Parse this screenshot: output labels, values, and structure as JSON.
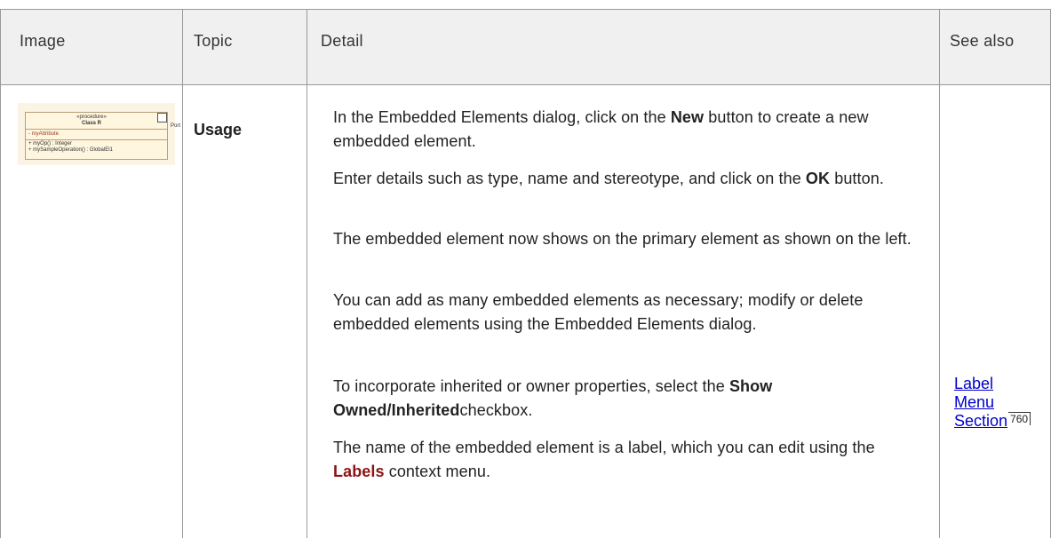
{
  "headers": {
    "image": "Image",
    "topic": "Topic",
    "detail": "Detail",
    "see_also": "See also"
  },
  "row": {
    "topic": "Usage",
    "thumbnail": {
      "stereotype": "«procedure»",
      "class_name": "Class R",
      "attribute": "-   myAttribute",
      "operation_1": "+   myOp() : Integer",
      "operation_2": "+   mySampleOperation() : GlobalEl1",
      "port_label": "Port"
    },
    "details": {
      "p1_a": "In the Embedded Elements dialog, click on the ",
      "p1_b": "New",
      "p1_c": " button to create a new embedded element.",
      "p2_a": "Enter details such as type, name and stereotype, and click on the ",
      "p2_b": "OK",
      "p2_c": " button.",
      "p3": "The embedded element now shows on the primary element as shown on the left.",
      "p4": "You can add as many embedded elements as necessary; modify or delete embedded elements using the Embedded Elements dialog.",
      "p5_a": "To incorporate inherited or owner properties, select the ",
      "p5_b": "Show Owned/Inherited",
      "p5_c": "checkbox.",
      "p6_a": "The name of the embedded element is a label, which you can edit using the ",
      "p6_b": "Labels",
      "p6_c": " context menu."
    },
    "see_also": {
      "link_line1": "Label",
      "link_line2": "Menu",
      "link_line3": "Section",
      "page_ref": "760"
    }
  },
  "colors": {
    "header_bg": "#f0f0f0",
    "grid": "#9a9a9a",
    "link": "#0000cc",
    "context_menu": "#8b1414"
  }
}
